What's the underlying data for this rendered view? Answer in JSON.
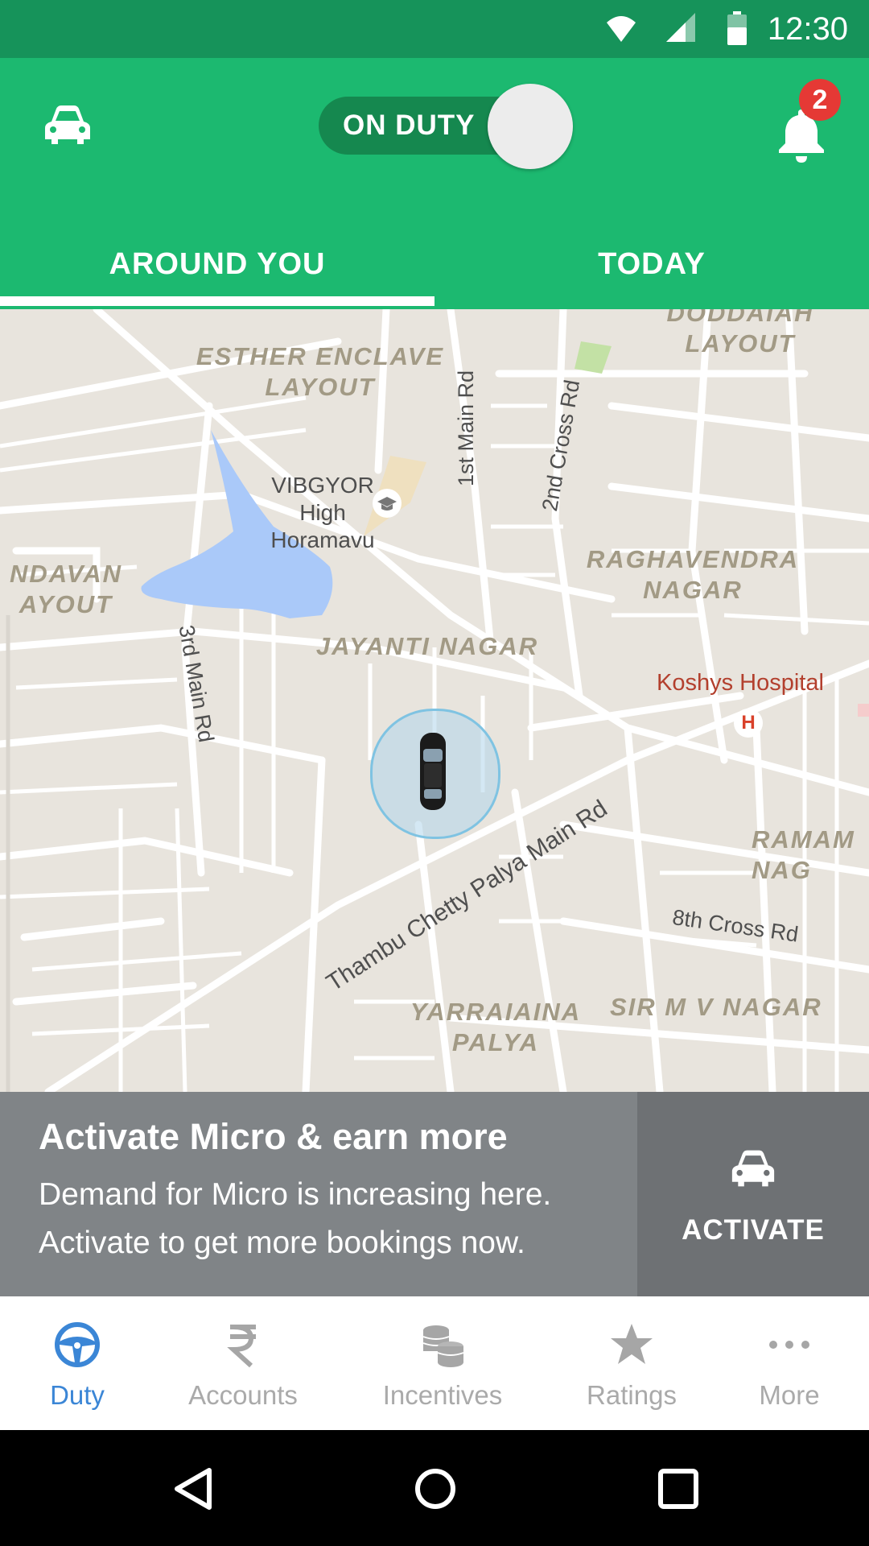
{
  "status_bar": {
    "time": "12:30"
  },
  "header": {
    "duty_toggle_label": "ON DUTY",
    "notification_count": "2",
    "tabs": [
      {
        "label": "AROUND YOU",
        "selected": true
      },
      {
        "label": "TODAY",
        "selected": false
      }
    ]
  },
  "map": {
    "areas": [
      "DODDAIAH LAYOUT",
      "ESTHER ENCLAVE LAYOUT",
      "NDAVAN AYOUT",
      "RAGHAVENDRA NAGAR",
      "JAYANTI NAGAR",
      "RAMAM NAG",
      "YARRAIAINA PALYA",
      "SIR M V NAGAR"
    ],
    "places": {
      "school": "VIBGYOR High Horamavu",
      "hospital": "Koshys Hospital",
      "hospital_marker": "H"
    },
    "roads": {
      "first_main": "1st Main Rd",
      "second_cross": "2nd Cross Rd",
      "third_main": "3rd Main Rd",
      "thambu": "Thambu Chetty Palya Main Rd",
      "eighth_cross": "8th Cross Rd"
    }
  },
  "promo_banner": {
    "title": "Activate Micro & earn more",
    "body": "Demand for Micro is increasing here. Activate to get more bookings now.",
    "button_label": "ACTIVATE"
  },
  "bottom_nav": [
    {
      "label": "Duty",
      "icon": "steering-wheel-icon",
      "active": true
    },
    {
      "label": "Accounts",
      "icon": "rupee-icon",
      "active": false
    },
    {
      "label": "Incentives",
      "icon": "coins-icon",
      "active": false
    },
    {
      "label": "Ratings",
      "icon": "star-icon",
      "active": false
    },
    {
      "label": "More",
      "icon": "more-icon",
      "active": false
    }
  ],
  "colors": {
    "status_bar": "#16935a",
    "app_bar": "#1cb970",
    "active_nav": "#3b86d6",
    "badge": "#e53935"
  }
}
